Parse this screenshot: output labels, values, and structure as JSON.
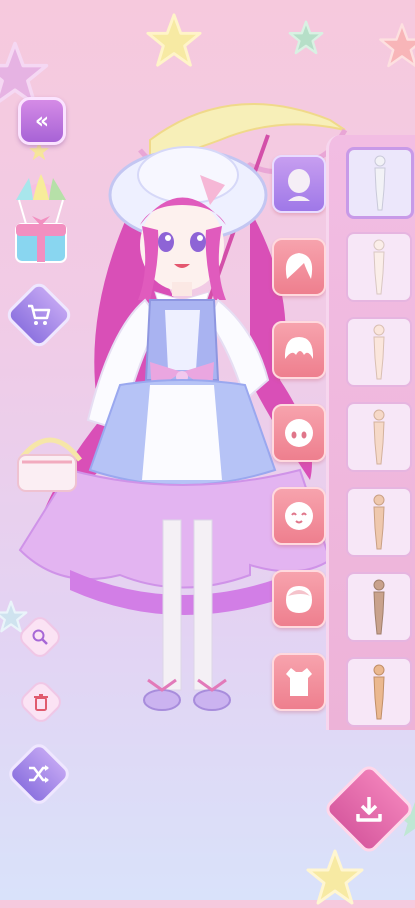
{
  "app": {
    "screen": "dress-up"
  },
  "toolbar_left": {
    "back_icon": "double-chevron-left-icon",
    "gift_icon": "parachute-gift-icon",
    "shop_icon": "shopping-cart-icon",
    "zoom_icon": "magnifier-icon",
    "delete_icon": "trash-icon",
    "random_icon": "shuffle-icon"
  },
  "categories": [
    {
      "id": "body",
      "icon": "body-base-icon",
      "active": true
    },
    {
      "id": "back-hair",
      "icon": "hair-back-icon",
      "active": false
    },
    {
      "id": "front-hair",
      "icon": "hair-front-icon",
      "active": false
    },
    {
      "id": "eyes",
      "icon": "eyes-icon",
      "active": false
    },
    {
      "id": "mouth",
      "icon": "mouth-icon",
      "active": false
    },
    {
      "id": "face",
      "icon": "face-icon",
      "active": false
    },
    {
      "id": "top",
      "icon": "top-clothes-icon",
      "active": false
    }
  ],
  "skin_items": [
    {
      "tone": "#f2f2f6",
      "selected": true
    },
    {
      "tone": "#fbeee9",
      "selected": false
    },
    {
      "tone": "#fbe6dc",
      "selected": false
    },
    {
      "tone": "#f6d9c8",
      "selected": false
    },
    {
      "tone": "#efc8ad",
      "selected": false
    },
    {
      "tone": "#c9a28c",
      "selected": false
    },
    {
      "tone": "#ebb88f",
      "selected": false
    }
  ],
  "actions": {
    "download_icon": "download-icon"
  },
  "colors": {
    "accent_purple": "#a763d6",
    "accent_pink": "#ee7f8e",
    "panel": "#efb8dd"
  }
}
